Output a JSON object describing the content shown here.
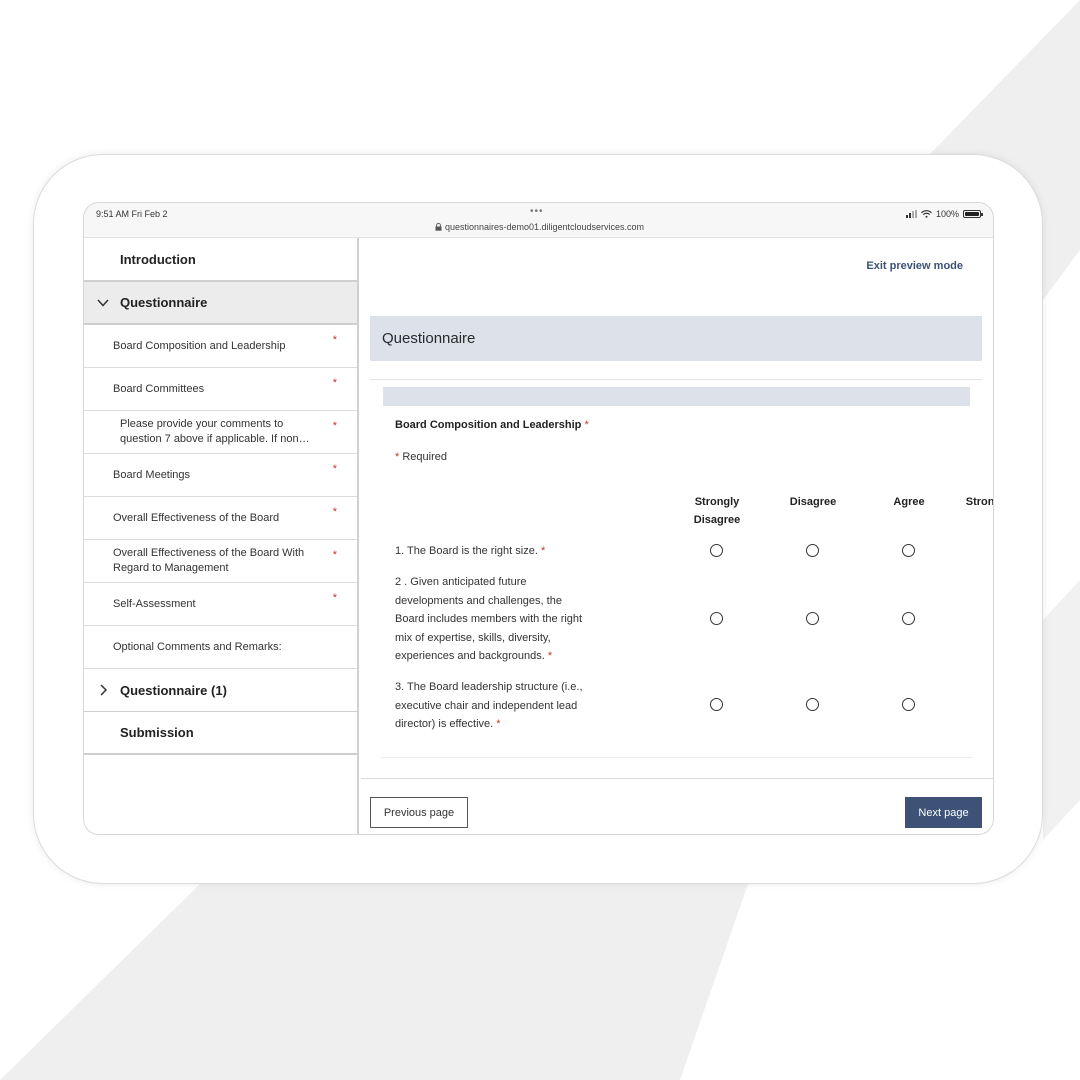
{
  "status_bar": {
    "time": "9:51 AM   Fri Feb 2",
    "dots": "•••",
    "url": "questionnaires-demo01.diligentcloudservices.com",
    "battery": "100%"
  },
  "sidebar": {
    "items": [
      {
        "label": "Introduction"
      },
      {
        "label": "Questionnaire"
      },
      {
        "label": "Board Composition and Leadership",
        "required": "*"
      },
      {
        "label": "Board Committees",
        "required": "*"
      },
      {
        "label": "Please provide your comments to question 7 above if applicable. If non…",
        "required": "*"
      },
      {
        "label": "Board Meetings",
        "required": "*"
      },
      {
        "label": "Overall Effectiveness of the Board",
        "required": "*"
      },
      {
        "label": "Overall Effectiveness of the Board With Regard to Management",
        "required": "*"
      },
      {
        "label": "Self-Assessment",
        "required": "*"
      },
      {
        "label": "Optional Comments and Remarks:"
      },
      {
        "label": "Questionnaire (1)"
      },
      {
        "label": "Submission"
      }
    ]
  },
  "main": {
    "exit_link": "Exit preview mode",
    "header_title": "Questionnaire",
    "section_title": "Board Composition and Leadership",
    "section_star": "*",
    "required_star": "*",
    "required_note": "Required",
    "columns": [
      "Strongly Disagree",
      "Disagree",
      "Agree",
      "Strongly Agree"
    ],
    "questions": [
      {
        "text": "1. The Board is the right size.",
        "star": "*"
      },
      {
        "text": "2 . Given anticipated future developments and challenges, the Board includes members with the right mix of expertise, skills, diversity, experiences and backgrounds.",
        "star": "*"
      },
      {
        "text": "3. The Board leadership structure (i.e., executive chair and independent lead director) is effective.",
        "star": "*"
      }
    ],
    "prev_button": "Previous page",
    "next_button": "Next page"
  },
  "colors": {
    "accent": "#3d5276",
    "header_bg": "#dde1e9",
    "required": "#c0392b"
  }
}
